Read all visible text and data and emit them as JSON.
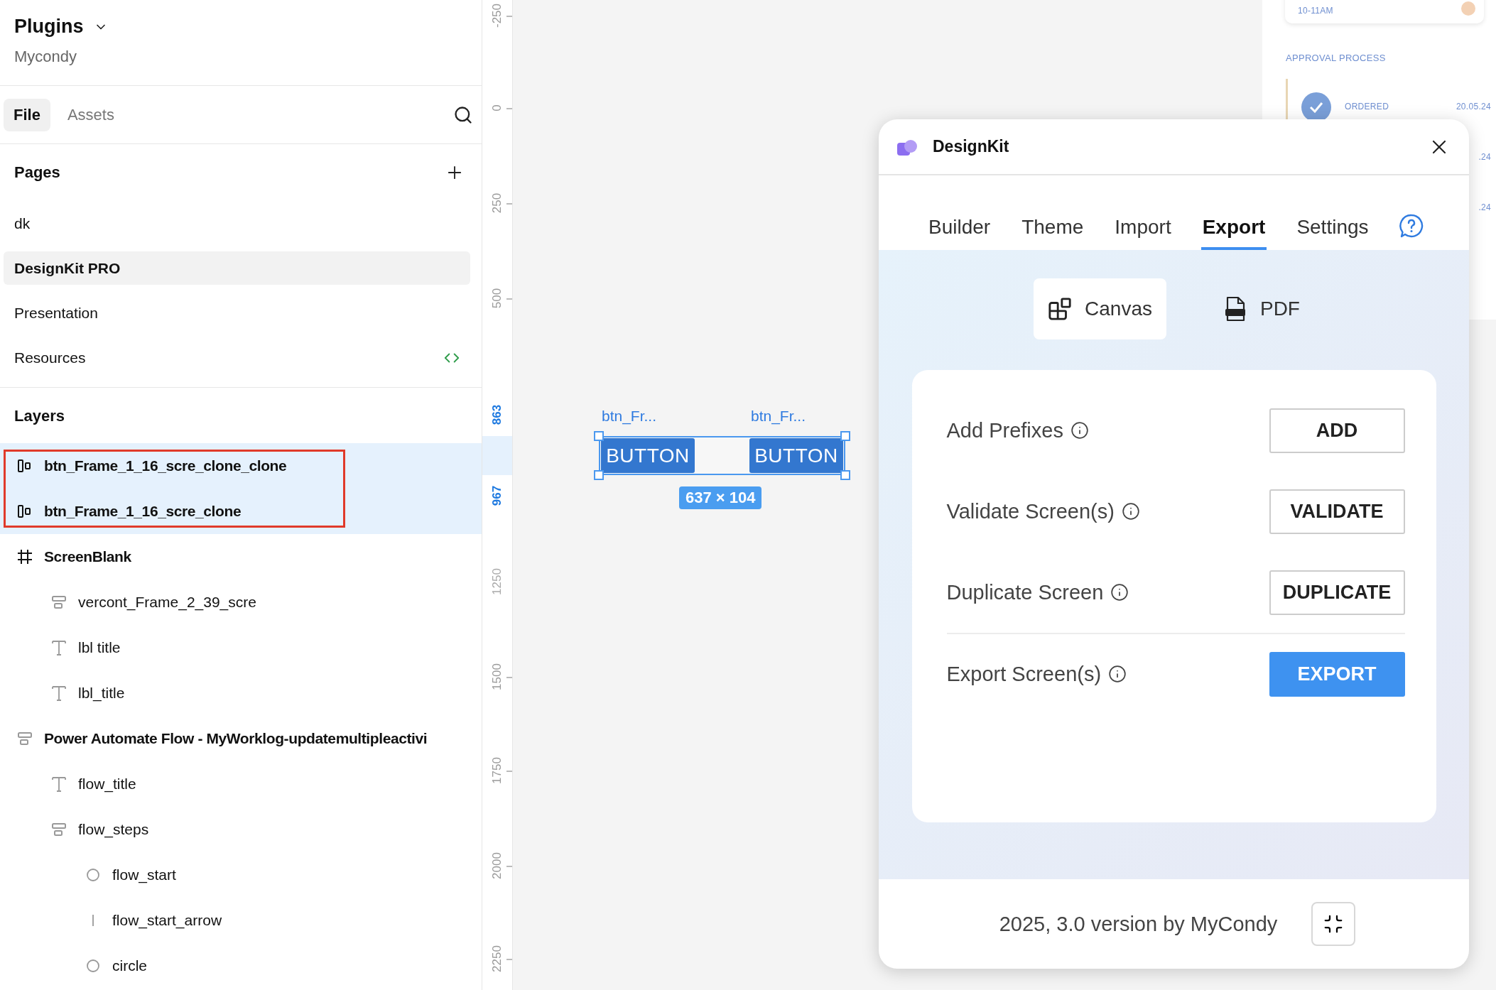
{
  "sidebar": {
    "title": "Plugins",
    "subtitle": "Mycondy",
    "tabs": [
      {
        "label": "File",
        "selected": true
      },
      {
        "label": "Assets",
        "selected": false
      }
    ],
    "pages": {
      "title": "Pages",
      "items": [
        {
          "label": "dk",
          "selected": false,
          "code_icon": false
        },
        {
          "label": "DesignKit PRO",
          "selected": true,
          "code_icon": false
        },
        {
          "label": "Presentation",
          "selected": false,
          "code_icon": false
        },
        {
          "label": "Resources",
          "selected": false,
          "code_icon": true
        }
      ]
    },
    "layers": {
      "title": "Layers",
      "annotation_box": true,
      "items": [
        {
          "label": "btn_Frame_1_16_scre_clone_clone",
          "kind": "component",
          "selected": true
        },
        {
          "label": "btn_Frame_1_16_scre_clone",
          "kind": "component",
          "selected": true
        },
        {
          "label": "ScreenBlank",
          "kind": "frame",
          "selected": false,
          "children": [
            {
              "label": "vercont_Frame_2_39_scre",
              "kind": "stack",
              "selected": false
            },
            {
              "label": "lbl title",
              "kind": "text",
              "selected": false
            },
            {
              "label": "lbl_title",
              "kind": "text",
              "selected": false
            }
          ]
        },
        {
          "label": "Power Automate Flow - MyWorklog-updatemultipleactivi",
          "kind": "stack",
          "selected": false,
          "children": [
            {
              "label": "flow_title",
              "kind": "text",
              "selected": false
            },
            {
              "label": "flow_steps",
              "kind": "stack",
              "selected": false,
              "children": [
                {
                  "label": "flow_start",
                  "kind": "ellipse",
                  "selected": false
                },
                {
                  "label": "flow_start_arrow",
                  "kind": "line",
                  "selected": false
                },
                {
                  "label": "circle",
                  "kind": "ellipse",
                  "selected": false
                }
              ]
            }
          ]
        }
      ]
    }
  },
  "ruler": {
    "ticks": [
      {
        "label": "-250",
        "kind": "normal"
      },
      {
        "label": "0",
        "kind": "normal"
      },
      {
        "label": "250",
        "kind": "normal"
      },
      {
        "label": "500",
        "kind": "normal"
      },
      {
        "label": "863",
        "kind": "selection"
      },
      {
        "label": "967",
        "kind": "selection"
      },
      {
        "label": "1250",
        "kind": "faded"
      },
      {
        "label": "1500",
        "kind": "normal"
      },
      {
        "label": "1750",
        "kind": "normal"
      },
      {
        "label": "2000",
        "kind": "normal"
      },
      {
        "label": "2250",
        "kind": "normal"
      }
    ]
  },
  "canvas": {
    "objects": [
      {
        "label": "btn_Fr...",
        "text": "BUTTON"
      },
      {
        "label": "btn_Fr...",
        "text": "BUTTON"
      }
    ],
    "selection_size": "637 × 104",
    "background_card": {
      "time": "10-11AM",
      "section": "APPROVAL PROCESS",
      "steps": [
        {
          "status": "ORDERED",
          "date": "20.05.24"
        },
        {
          "date": ".24"
        },
        {
          "date": ".24"
        }
      ]
    }
  },
  "plugin": {
    "title": "DesignKit",
    "tabs": [
      {
        "label": "Builder",
        "selected": false
      },
      {
        "label": "Theme",
        "selected": false
      },
      {
        "label": "Import",
        "selected": false
      },
      {
        "label": "Export",
        "selected": true
      },
      {
        "label": "Settings",
        "selected": false
      }
    ],
    "modes": [
      {
        "label": "Canvas",
        "kind": "canvas",
        "selected": true
      },
      {
        "label": "PDF",
        "kind": "pdf",
        "selected": false
      }
    ],
    "actions": [
      {
        "label": "Add Prefixes",
        "button": "ADD",
        "kind": "secondary"
      },
      {
        "label": "Validate Screen(s)",
        "button": "VALIDATE",
        "kind": "secondary"
      },
      {
        "label": "Duplicate Screen",
        "button": "DUPLICATE",
        "kind": "secondary"
      },
      {
        "label": "Export Screen(s)",
        "button": "EXPORT",
        "kind": "primary"
      }
    ],
    "footer": "2025, 3.0 version by MyCondy"
  }
}
